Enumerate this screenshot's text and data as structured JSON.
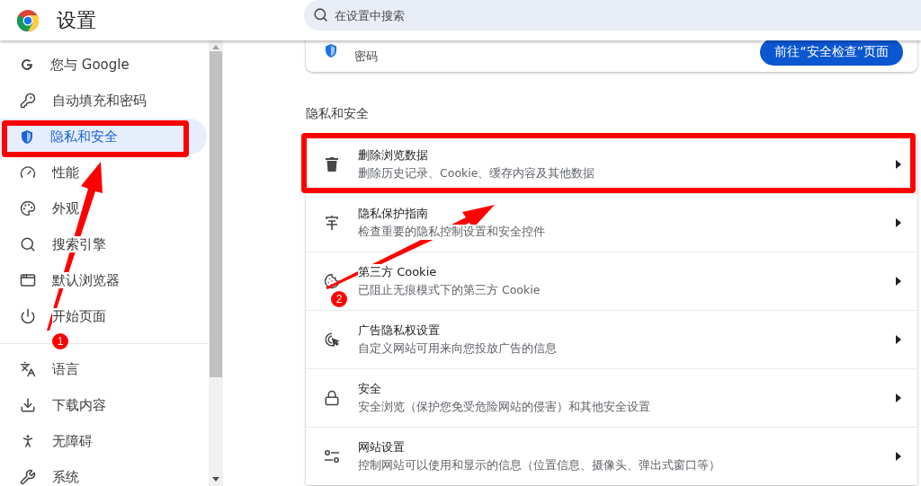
{
  "header": {
    "title": "设置",
    "search": {
      "placeholder": "在设置中搜索"
    }
  },
  "sidebar": {
    "sections": [
      {
        "items": [
          {
            "label": "您与 Google",
            "selected": false
          },
          {
            "label": "自动填充和密码",
            "selected": false
          },
          {
            "label": "隐私和安全",
            "selected": true
          },
          {
            "label": "性能",
            "selected": false
          },
          {
            "label": "外观",
            "selected": false
          },
          {
            "label": "搜索引擎",
            "selected": false
          },
          {
            "label": "默认浏览器",
            "selected": false
          },
          {
            "label": "开始页面",
            "selected": false
          }
        ]
      },
      {
        "items": [
          {
            "label": "语言",
            "selected": false
          },
          {
            "label": "下载内容",
            "selected": false
          },
          {
            "label": "无障碍",
            "selected": false
          },
          {
            "label": "系统",
            "selected": false
          }
        ]
      }
    ]
  },
  "safety_card": {
    "text": "密码",
    "button": "前往“安全检查”页面"
  },
  "privacy": {
    "title": "隐私和安全",
    "rows": [
      {
        "title": "删除浏览数据",
        "subtitle": "删除历史记录、Cookie、缓存内容及其他数据"
      },
      {
        "title": "隐私保护指南",
        "subtitle": "检查重要的隐私控制设置和安全控件"
      },
      {
        "title": "第三方 Cookie",
        "subtitle": "已阻止无痕模式下的第三方 Cookie"
      },
      {
        "title": "广告隐私权设置",
        "subtitle": "自定义网站可用来向您投放广告的信息"
      },
      {
        "title": "安全",
        "subtitle": "安全浏览（保护您免受危险网站的侵害）和其他安全设置"
      },
      {
        "title": "网站设置",
        "subtitle": "控制网站可以使用和显示的信息（位置信息、摄像头、弹出式窗口等）"
      }
    ]
  },
  "annotations": [
    {
      "badge": "1"
    },
    {
      "badge": "2"
    }
  ]
}
